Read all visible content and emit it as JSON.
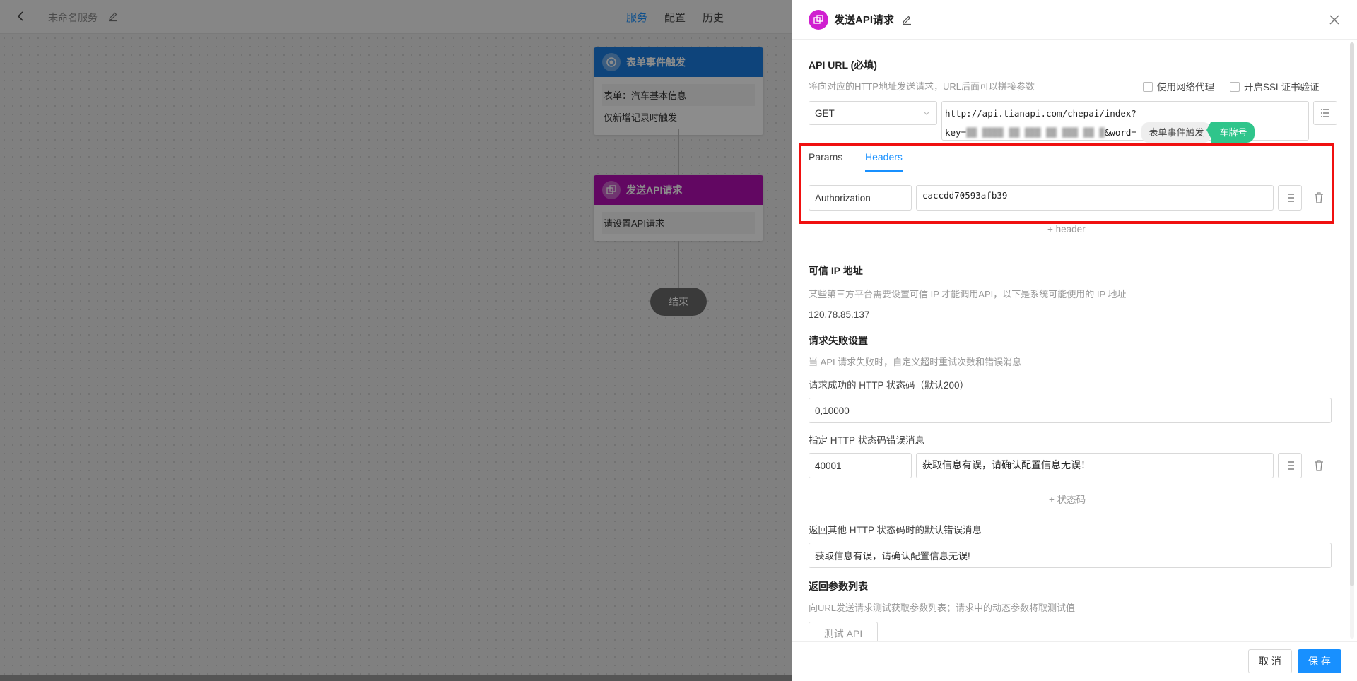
{
  "topbar": {
    "service_name": "未命名服务",
    "tabs": [
      {
        "label": "服务",
        "active": true
      },
      {
        "label": "配置",
        "active": false
      },
      {
        "label": "历史",
        "active": false
      }
    ]
  },
  "flow": {
    "trigger_node": {
      "title": "表单事件触发",
      "rows": [
        "表单：汽车基本信息",
        "仅新增记录时触发"
      ]
    },
    "api_node": {
      "title": "发送API请求",
      "rows": [
        "请设置API请求"
      ]
    },
    "end_node": "结束"
  },
  "drawer": {
    "title": "发送API请求",
    "api_url": {
      "label": "API URL (必填)",
      "hint": "将向对应的HTTP地址发送请求，URL后面可以拼接参数",
      "use_proxy": "使用网络代理",
      "ssl_verify": "开启SSL证书验证",
      "method": "GET",
      "url_line1": "http://api.tianapi.com/chepai/index?",
      "url_key_prefix": "key=",
      "url_key_masked": "▓▓ ▓▓▓▓ ▓▓ ▓▓▓ ▓▓ ▓▓▓ ▓▓ ▓",
      "url_word": "&word=",
      "token_source": "表单事件触发",
      "token_field": "车牌号"
    },
    "tabs": [
      {
        "label": "Params",
        "active": false
      },
      {
        "label": "Headers",
        "active": true
      }
    ],
    "header_row": {
      "key": "Authorization",
      "value": "caccdd70593afb39"
    },
    "add_header": "+ header",
    "trusted_ip": {
      "title": "可信 IP 地址",
      "hint": "某些第三方平台需要设置可信 IP 才能调用API，以下是系统可能使用的 IP 地址",
      "ip": "120.78.85.137"
    },
    "failure": {
      "title": "请求失败设置",
      "hint": "当 API 请求失败时，自定义超时重试次数和错误消息",
      "success_code_label": "请求成功的 HTTP 状态码（默认200）",
      "success_code_value": "0,10000",
      "error_msg_label": "指定 HTTP 状态码错误消息",
      "error_code": "40001",
      "error_msg": "获取信息有误，请确认配置信息无误！",
      "add_code": "+ 状态码",
      "default_msg_label": "返回其他 HTTP 状态码时的默认错误消息",
      "default_msg": "获取信息有误，请确认配置信息无误!"
    },
    "return_params": {
      "title": "返回参数列表",
      "hint": "向URL发送请求测试获取参数列表；请求中的动态参数将取测试值",
      "test_button": "测试 API"
    },
    "footer": {
      "cancel": "取 消",
      "save": "保 存"
    }
  },
  "colors": {
    "accent": "#1890ff",
    "trigger_node": "#1b7de0",
    "api_node": "#b20db2",
    "highlight_box": "#f01010",
    "token_green": "#2fc58b"
  }
}
